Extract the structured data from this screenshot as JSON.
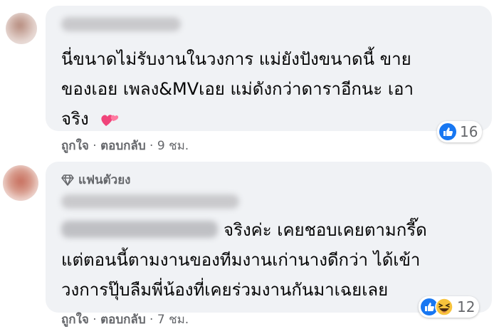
{
  "comments": [
    {
      "text_lines": [
        "นี่ขนาดไม่รับงานในวงการ แม่ยังปังขนาดนี้ ขาย",
        "ของเอย เพลง&MVเอย แม่ดังกว่าดาราอีกนะ เอา",
        "จริง"
      ],
      "like_label": "ถูกใจ",
      "reply_label": "ตอบกลับ",
      "separator": "·",
      "time": "9 ชม.",
      "reaction_count": "16",
      "reaction_icons": [
        "like-icon"
      ],
      "emoji": "two-hearts-icon"
    },
    {
      "badge_label": "แฟนตัวยง",
      "badge_icon": "diamond-icon",
      "mention_suffix": "จริงค่ะ เคยชอบเคยตามกรี๊ด",
      "text_lines": [
        "แต่ตอนนี้ตามงานของทีมงานเก่านางดีกว่า ได้เข้า",
        "วงการปุ๊บลืมพี่น้องที่เคยร่วมงานกันมาเฉยเลย"
      ],
      "like_label": "ถูกใจ",
      "reply_label": "ตอบกลับ",
      "separator": "·",
      "time": "7 ชม.",
      "reaction_count": "12",
      "reaction_icons": [
        "like-icon",
        "laugh-icon"
      ]
    }
  ],
  "colors": {
    "bubble": "#f0f2f5",
    "like_blue": "#1877f2",
    "meta_gray": "#65676b",
    "text": "#050505"
  }
}
